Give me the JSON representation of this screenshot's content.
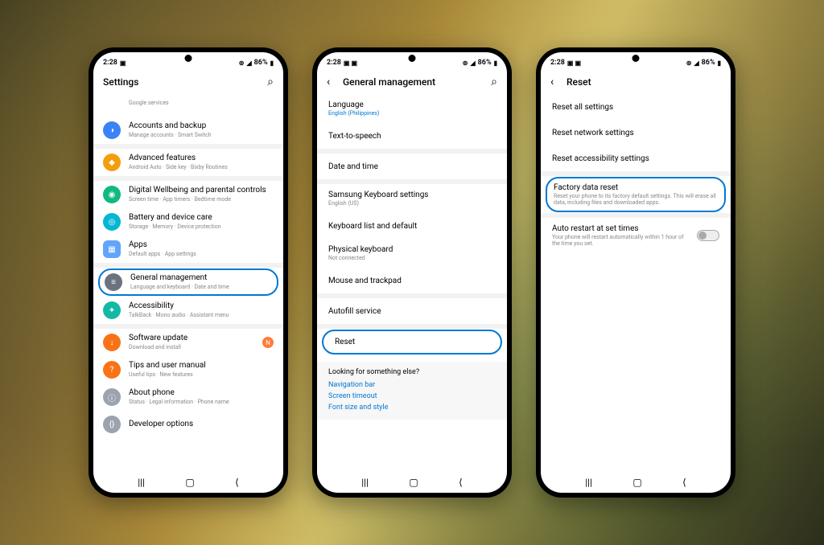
{
  "status": {
    "time": "2:28",
    "battery_text": "86%"
  },
  "phone1": {
    "header_title": "Settings",
    "items": [
      {
        "title": "Google services",
        "sub": ""
      },
      {
        "title": "Accounts and backup",
        "sub": "Manage accounts · Smart Switch"
      },
      {
        "title": "Advanced features",
        "sub": "Android Auto · Side key · Bixby Routines"
      },
      {
        "title": "Digital Wellbeing and parental controls",
        "sub": "Screen time · App timers · Bedtime mode"
      },
      {
        "title": "Battery and device care",
        "sub": "Storage · Memory · Device protection"
      },
      {
        "title": "Apps",
        "sub": "Default apps · App settings"
      },
      {
        "title": "General management",
        "sub": "Language and keyboard · Date and time"
      },
      {
        "title": "Accessibility",
        "sub": "TalkBack · Mono audio · Assistant menu"
      },
      {
        "title": "Software update",
        "sub": "Download and install"
      },
      {
        "title": "Tips and user manual",
        "sub": "Useful tips · New features"
      },
      {
        "title": "About phone",
        "sub": "Status · Legal information · Phone name"
      },
      {
        "title": "Developer options",
        "sub": ""
      }
    ]
  },
  "phone2": {
    "header_title": "General management",
    "items": [
      {
        "title": "Language",
        "sub": "English (Philippines)",
        "blue": true
      },
      {
        "title": "Text-to-speech",
        "sub": ""
      },
      {
        "title": "Date and time",
        "sub": ""
      },
      {
        "title": "Samsung Keyboard settings",
        "sub": "English (US)"
      },
      {
        "title": "Keyboard list and default",
        "sub": ""
      },
      {
        "title": "Physical keyboard",
        "sub": "Not connected"
      },
      {
        "title": "Mouse and trackpad",
        "sub": ""
      },
      {
        "title": "Autofill service",
        "sub": ""
      },
      {
        "title": "Reset",
        "sub": ""
      }
    ],
    "suggest_header": "Looking for something else?",
    "suggest_links": [
      "Navigation bar",
      "Screen timeout",
      "Font size and style"
    ]
  },
  "phone3": {
    "header_title": "Reset",
    "items": [
      {
        "title": "Reset all settings",
        "sub": ""
      },
      {
        "title": "Reset network settings",
        "sub": ""
      },
      {
        "title": "Reset accessibility settings",
        "sub": ""
      },
      {
        "title": "Factory data reset",
        "sub": "Reset your phone to its factory default settings. This will erase all data, including files and downloaded apps."
      }
    ],
    "auto": {
      "title": "Auto restart at set times",
      "sub": "Your phone will restart automatically within 1 hour of the time you set."
    }
  }
}
